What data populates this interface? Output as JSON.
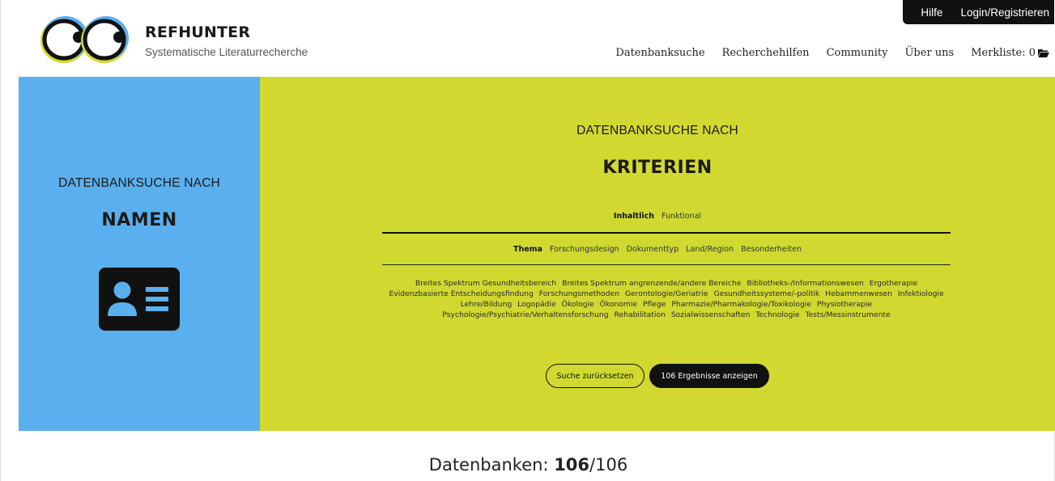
{
  "header": {
    "brand_name": "REFHUNTER",
    "brand_subtitle": "Systematische Literaturrecherche",
    "topbar": [
      "Hilfe",
      "Login/Registrieren"
    ],
    "nav": [
      "Datenbanksuche",
      "Recherchehilfen",
      "Community",
      "Über uns"
    ],
    "merkliste": "Merkliste: 0"
  },
  "name_panel": {
    "kicker": "DATENBANKSUCHE NACH",
    "title": "NAMEN",
    "icon": "id-card-icon",
    "color": "#5ab0ee"
  },
  "criteria_panel": {
    "kicker": "DATENBANKSUCHE NACH",
    "title": "KRITERIEN",
    "color": "#d1d930",
    "tabs": [
      "Inhaltlich",
      "Funktional"
    ],
    "active_tab": "Inhaltlich",
    "subtabs": [
      "Thema",
      "Forschungsdesign",
      "Dokumenttyp",
      "Land/Region",
      "Besonderheiten"
    ],
    "active_subtab": "Thema",
    "topics": [
      "Breites Spektrum Gesundheitsbereich",
      "Breites Spektrum angrenzende/andere Bereiche",
      "Bibliotheks-/Informationswesen",
      "Ergotherapie",
      "Evidenzbasierte Entscheidungsfindung",
      "Forschungsmethoden",
      "Gerontologie/Geriatrie",
      "Gesundheitssysteme/-politik",
      "Hebammenwesen",
      "Infektiologie",
      "Lehre/Bildung",
      "Logopädie",
      "Ökologie",
      "Ökonomie",
      "Pflege",
      "Pharmazie/Pharmakologie/Toxikologie",
      "Physiotherapie",
      "Psychologie/Psychiatrie/Verhaltensforschung",
      "Rehabilitation",
      "Sozialwissenschaften",
      "Technologie",
      "Tests/Messinstrumente"
    ],
    "reset_button": "Suche zurücksetzen",
    "show_button": "106 Ergebnisse anzeigen"
  },
  "results": {
    "label": "Datenbanken: ",
    "shown": "106",
    "total": "/106"
  }
}
